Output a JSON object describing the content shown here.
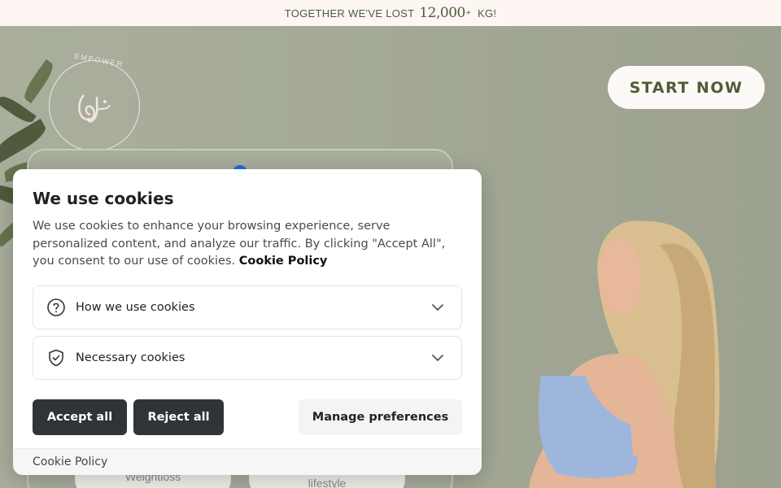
{
  "announcement": {
    "prefix": "TOGETHER WE'VE LOST",
    "number": "12,000",
    "plus": "+",
    "suffix": "KG!"
  },
  "logo": {
    "ring_text": "EMPOWER"
  },
  "header": {
    "cta_label": "START NOW"
  },
  "hero": {
    "pills": [
      "Weightloss",
      "lifestyle"
    ]
  },
  "cookie_banner": {
    "title": "We use cookies",
    "description": "We use cookies to enhance your browsing experience, serve personalized content, and analyze our traffic. By clicking \"Accept All\", you consent to our use of cookies.",
    "policy_link": "Cookie Policy",
    "sections": [
      {
        "label": "How we use cookies",
        "icon": "question-circle-icon"
      },
      {
        "label": "Necessary cookies",
        "icon": "shield-check-icon"
      }
    ],
    "buttons": {
      "accept": "Accept all",
      "reject": "Reject all",
      "manage": "Manage preferences"
    },
    "footer_link": "Cookie Policy"
  },
  "colors": {
    "brand_green": "#4e5d34",
    "button_dark": "#2f3437",
    "topbar_bg": "#fdf6f3"
  }
}
